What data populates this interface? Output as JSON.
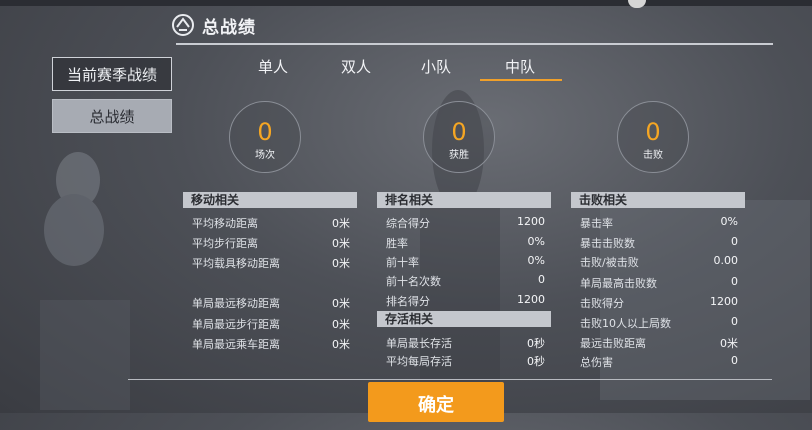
{
  "header": {
    "title": "总战绩"
  },
  "sidebar": {
    "items": [
      {
        "label": "当前赛季战绩"
      },
      {
        "label": "总战绩"
      }
    ]
  },
  "tabs": [
    {
      "label": "单人"
    },
    {
      "label": "双人"
    },
    {
      "label": "小队"
    },
    {
      "label": "中队",
      "active": true
    }
  ],
  "summary": [
    {
      "value": "0",
      "label": "场次"
    },
    {
      "value": "0",
      "label": "获胜"
    },
    {
      "value": "0",
      "label": "击败"
    }
  ],
  "movement": {
    "heading": "移动相关",
    "rows": [
      {
        "label": "平均移动距离",
        "value": "0米"
      },
      {
        "label": "平均步行距离",
        "value": "0米"
      },
      {
        "label": "平均载具移动距离",
        "value": "0米"
      },
      {
        "label": "单局最远移动距离",
        "value": "0米"
      },
      {
        "label": "单局最远步行距离",
        "value": "0米"
      },
      {
        "label": "单局最远乘车距离",
        "value": "0米"
      }
    ]
  },
  "ranking": {
    "heading": "排名相关",
    "rows": [
      {
        "label": "综合得分",
        "value": "1200"
      },
      {
        "label": "胜率",
        "value": "0%"
      },
      {
        "label": "前十率",
        "value": "0%"
      },
      {
        "label": "前十名次数",
        "value": "0"
      },
      {
        "label": "排名得分",
        "value": "1200"
      }
    ]
  },
  "survival": {
    "heading": "存活相关",
    "rows": [
      {
        "label": "单局最长存活",
        "value": "0秒"
      },
      {
        "label": "平均每局存活",
        "value": "0秒"
      }
    ]
  },
  "kills": {
    "heading": "击败相关",
    "rows": [
      {
        "label": "暴击率",
        "value": "0%"
      },
      {
        "label": "暴击击败数",
        "value": "0"
      },
      {
        "label": "击败/被击败",
        "value": "0.00"
      },
      {
        "label": "单局最高击败数",
        "value": "0"
      },
      {
        "label": "击败得分",
        "value": "1200"
      },
      {
        "label": "击败10人以上局数",
        "value": "0"
      },
      {
        "label": "最远击败距离",
        "value": "0米"
      },
      {
        "label": "总伤害",
        "value": "0"
      }
    ]
  },
  "footer": {
    "confirm_label": "确定"
  },
  "colors": {
    "accent": "#f39a1c",
    "value_orange": "#f5a623",
    "header_bg": "#c4c7cd"
  }
}
